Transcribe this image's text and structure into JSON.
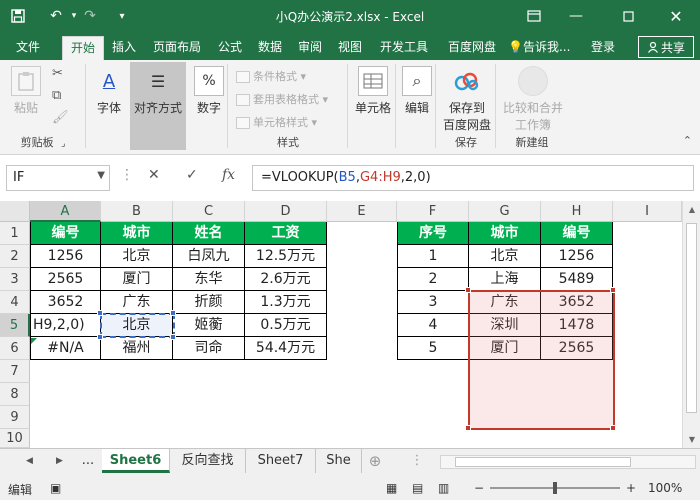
{
  "window": {
    "title": "小Q办公演示2.xlsx - Excel",
    "save_icon": "save-icon",
    "undo_icon": "undo-icon",
    "redo_icon": "redo-icon",
    "customize_icon": "customize-quick-access-icon",
    "ribbon_options_icon": "ribbon-display-options-icon",
    "minimize_icon": "minimize-icon",
    "restore_icon": "restore-icon",
    "close_icon": "close-icon"
  },
  "menu": {
    "tabs": [
      {
        "label": "文件"
      },
      {
        "label": "开始"
      },
      {
        "label": "插入"
      },
      {
        "label": "页面布局"
      },
      {
        "label": "公式"
      },
      {
        "label": "数据"
      },
      {
        "label": "审阅"
      },
      {
        "label": "视图"
      },
      {
        "label": "开发工具"
      },
      {
        "label": "百度网盘"
      },
      {
        "label": "告诉我..."
      }
    ],
    "active_tab": "开始",
    "login": "登录",
    "share": "共享",
    "tell_icon": "lightbulb-icon",
    "share_icon": "user-icon"
  },
  "ribbon": {
    "clipboard": {
      "paste": "粘贴",
      "label": "剪贴板",
      "cut_icon": "scissors-icon",
      "copy_icon": "copy-icon",
      "format_painter_icon": "format-painter-icon"
    },
    "font": {
      "label": "字体",
      "icon": "font-icon"
    },
    "alignment": {
      "label": "对齐方式",
      "icon": "align-icon"
    },
    "number": {
      "label": "数字",
      "icon": "percent-icon"
    },
    "styles": {
      "conditional": "条件格式",
      "table_format": "套用表格格式",
      "cell_style": "单元格样式",
      "label": "样式"
    },
    "cells": {
      "label": "单元格",
      "icon": "cells-icon"
    },
    "editing": {
      "label": "编辑",
      "icon": "magnifier-icon"
    },
    "save_baidu": {
      "line1": "保存到",
      "line2": "百度网盘",
      "label": "保存",
      "icon": "cloud-upload-icon"
    },
    "merge": {
      "line1": "比较和合并",
      "line2": "工作簿",
      "label": "新建组",
      "icon": "merge-icon"
    },
    "collapse_icon": "collapse-ribbon-icon"
  },
  "formula_bar": {
    "name_box": "IF",
    "cancel_icon": "cancel-icon",
    "enter_icon": "check-icon",
    "fx_label": "fx",
    "formula_prefix": "=VLOOKUP(",
    "ref1": "B5",
    "comma1": ",",
    "ref2": "G4:H9",
    "formula_suffix": ",2,0)"
  },
  "sheet": {
    "columns": [
      "A",
      "B",
      "C",
      "D",
      "E",
      "F",
      "G",
      "H",
      "I"
    ],
    "rows": [
      "1",
      "2",
      "3",
      "4",
      "5",
      "6",
      "7",
      "8",
      "9",
      "10"
    ],
    "table1": {
      "headers": [
        "编号",
        "城市",
        "姓名",
        "工资"
      ],
      "rows": [
        [
          "1256",
          "北京",
          "白凤九",
          "12.5万元"
        ],
        [
          "2565",
          "厦门",
          "东华",
          "2.6万元"
        ],
        [
          "3652",
          "广东",
          "折颜",
          "1.3万元"
        ],
        [
          "H9,2,0)",
          "北京",
          "姬蘅",
          "0.5万元"
        ],
        [
          "#N/A",
          "福州",
          "司命",
          "54.4万元"
        ]
      ]
    },
    "table2": {
      "headers": [
        "序号",
        "城市",
        "编号"
      ],
      "rows": [
        [
          "1",
          "北京",
          "1256"
        ],
        [
          "2",
          "上海",
          "5489"
        ],
        [
          "3",
          "广东",
          "3652"
        ],
        [
          "4",
          "深圳",
          "1478"
        ],
        [
          "5",
          "厦门",
          "2565"
        ]
      ]
    },
    "colors": {
      "header_bg": "#00b050",
      "ref1_border": "#3b6ec4",
      "ref2_border": "#c0392b"
    }
  },
  "sheet_tabs": {
    "more": "...",
    "tabs": [
      "Sheet6",
      "反向查找",
      "Sheet7",
      "She"
    ],
    "active": "Sheet6",
    "add_icon": "add-sheet-icon",
    "prev_icon": "scroll-left-icon",
    "next_icon": "scroll-right-icon"
  },
  "status": {
    "mode": "编辑",
    "macro_icon": "macro-record-icon",
    "zoom_out": "−",
    "zoom_in": "+",
    "zoom": "100%"
  }
}
